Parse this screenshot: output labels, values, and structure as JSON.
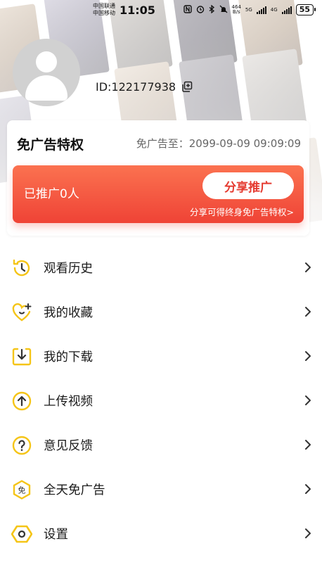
{
  "status_bar": {
    "carrier_1": "中国联通",
    "carrier_2": "中国移动",
    "time": "11:05",
    "net_speed_value": "464",
    "net_speed_unit": "B/s",
    "net_5g": "5G",
    "net_4g": "4G",
    "battery": "55"
  },
  "profile": {
    "user_id": "ID:122177938"
  },
  "ad_free": {
    "title": "免广告特权",
    "expiry": "免广告至：2099-09-09 09:09:09",
    "promoted_count": "已推广0人",
    "share_button": "分享推广",
    "share_tip": "分享可得终身免广告特权>"
  },
  "menu": [
    {
      "label": "观看历史",
      "icon": "history-icon"
    },
    {
      "label": "我的收藏",
      "icon": "favorite-heart-icon"
    },
    {
      "label": "我的下载",
      "icon": "download-icon"
    },
    {
      "label": "上传视频",
      "icon": "upload-icon"
    },
    {
      "label": "意见反馈",
      "icon": "feedback-question-icon"
    },
    {
      "label": "全天免广告",
      "icon": "ad-free-icon"
    },
    {
      "label": "设置",
      "icon": "settings-hexagon-icon"
    }
  ],
  "colors": {
    "accent_yellow": "#f5c518",
    "promo_red": "#ef4336",
    "share_text": "#e53b31"
  }
}
